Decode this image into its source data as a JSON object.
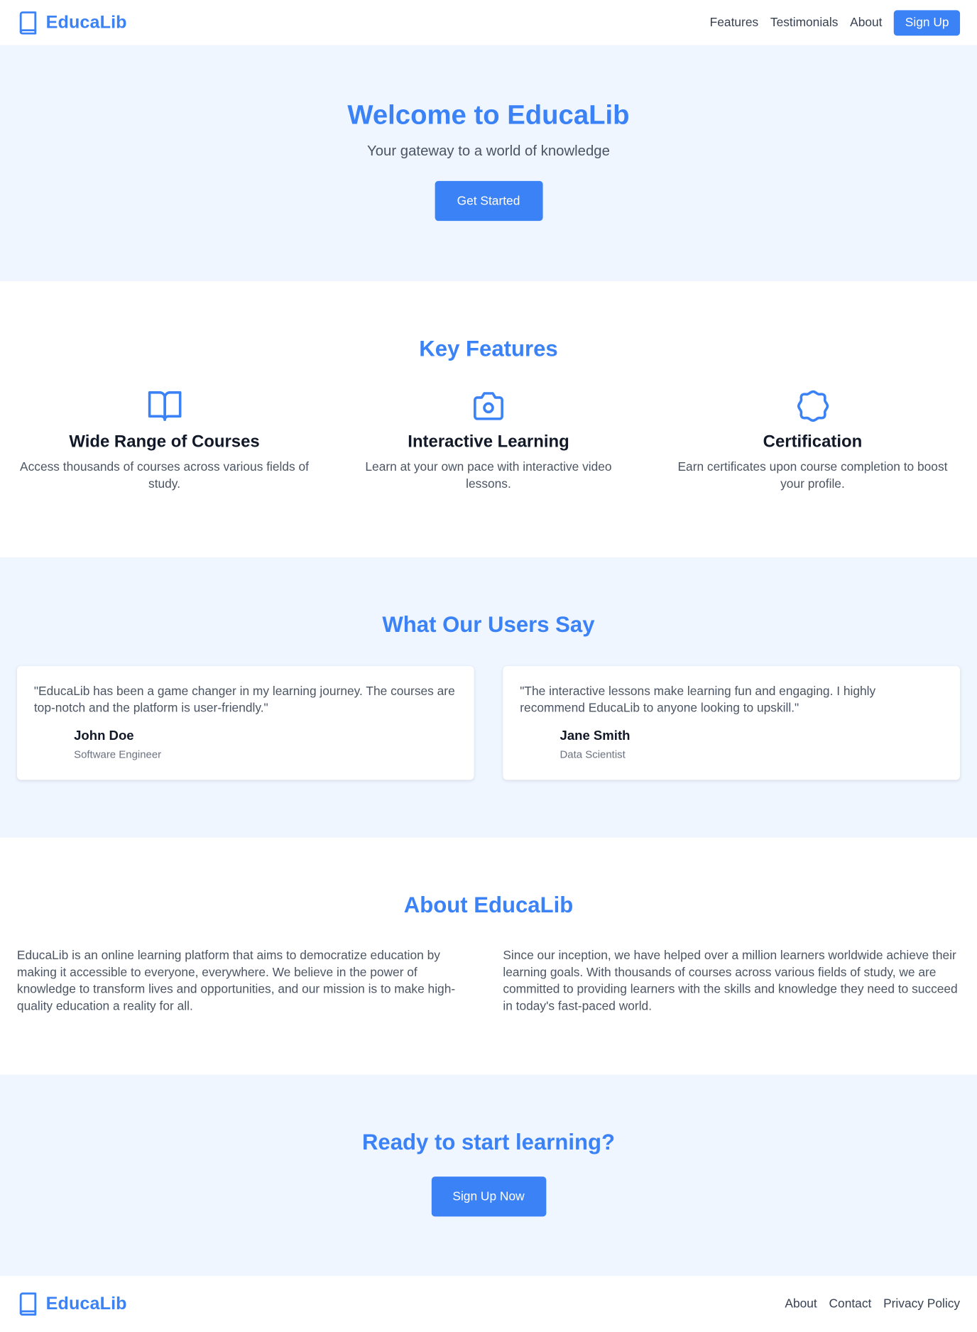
{
  "brand": {
    "name": "EducaLib",
    "color": "#3b82f6",
    "icon": "book-icon"
  },
  "nav": {
    "links": [
      "Features",
      "Testimonials",
      "About"
    ],
    "signup_label": "Sign Up"
  },
  "hero": {
    "title": "Welcome to EducaLib",
    "subtitle": "Your gateway to a world of knowledge",
    "cta_label": "Get Started"
  },
  "features": {
    "title": "Key Features",
    "items": [
      {
        "icon": "open-book-icon",
        "title": "Wide Range of Courses",
        "text": "Access thousands of courses across various fields of study."
      },
      {
        "icon": "camera-icon",
        "title": "Interactive Learning",
        "text": "Learn at your own pace with interactive video lessons."
      },
      {
        "icon": "badge-icon",
        "title": "Certification",
        "text": "Earn certificates upon course completion to boost your profile."
      }
    ]
  },
  "testimonials": {
    "title": "What Our Users Say",
    "items": [
      {
        "quote": "\"EducaLib has been a game changer in my learning journey. The courses are top-notch and the platform is user-friendly.\"",
        "name": "John Doe",
        "role": "Software Engineer"
      },
      {
        "quote": "\"The interactive lessons make learning fun and engaging. I highly recommend EducaLib to anyone looking to upskill.\"",
        "name": "Jane Smith",
        "role": "Data Scientist"
      }
    ]
  },
  "about": {
    "title": "About EducaLib",
    "paragraphs": [
      "EducaLib is an online learning platform that aims to democratize education by making it accessible to everyone, everywhere. We believe in the power of knowledge to transform lives and opportunities, and our mission is to make high-quality education a reality for all.",
      "Since our inception, we have helped over a million learners worldwide achieve their learning goals. With thousands of courses across various fields of study, we are committed to providing learners with the skills and knowledge they need to succeed in today's fast-paced world."
    ]
  },
  "cta": {
    "title": "Ready to start learning?",
    "button_label": "Sign Up Now"
  },
  "footer": {
    "brand_name": "EducaLib",
    "links": [
      "About",
      "Contact",
      "Privacy Policy"
    ]
  }
}
